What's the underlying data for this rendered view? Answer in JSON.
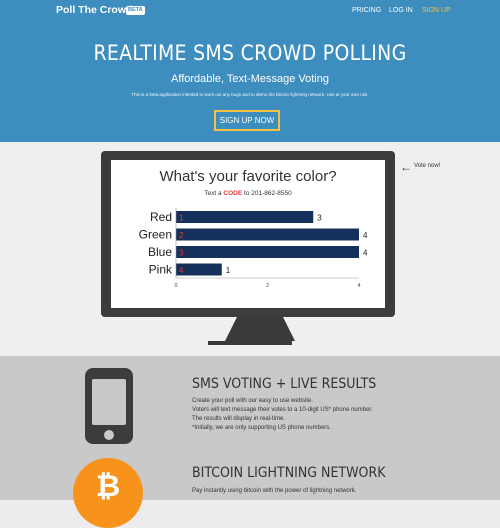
{
  "navbar": {
    "brand": "Poll The Crowd",
    "beta": "BETA",
    "links": {
      "pricing": "PRICING",
      "login": "LOG IN",
      "signup": "SIGN UP"
    }
  },
  "hero": {
    "title": "REALTIME SMS CROWD POLLING",
    "subtitle": "Affordable, Text-Message Voting",
    "note": "This is a beta application intented to work out any bugs and to demo the bitcoin lightning network. Use at your own risk.",
    "cta": "SIGN UP NOW"
  },
  "poll": {
    "question": "What's your favorite color?",
    "instruction_prefix": "Text a ",
    "instruction_code": "CODE",
    "instruction_suffix": " to 201-862-8550",
    "vote_now": "Vote now!",
    "bar_color": "#15305a",
    "code_color": "#e23b3b"
  },
  "chart_data": {
    "type": "bar",
    "orientation": "horizontal",
    "categories": [
      "Red",
      "Green",
      "Blue",
      "Pink"
    ],
    "codes": [
      "1",
      "2",
      "3",
      "4"
    ],
    "values": [
      3,
      4,
      4,
      1
    ],
    "xlim": [
      0,
      4
    ],
    "xticks": [
      "0",
      "2",
      "4"
    ]
  },
  "features": [
    {
      "icon": "phone-icon",
      "title": "SMS VOTING + LIVE RESULTS",
      "lines": [
        "Create your poll with our easy to use website.",
        "Voters will text message their votes to a 10-digit US* phone number.",
        "The results will display in real-time.",
        "*Initially, we are only supporting US phone numbers."
      ]
    },
    {
      "icon": "bitcoin-icon",
      "title": "BITCOIN LIGHTNING NETWORK",
      "lines": [
        "Pay instantly using bitcoin with the power of lightning network."
      ]
    }
  ]
}
